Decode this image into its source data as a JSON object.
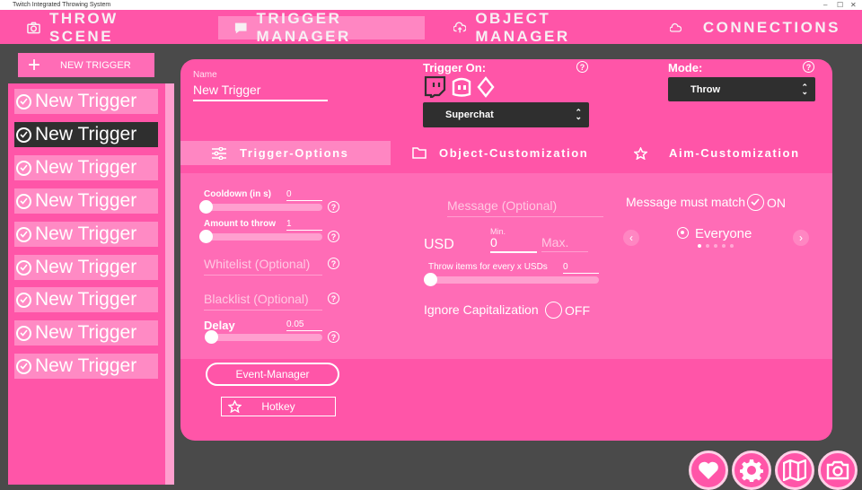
{
  "window": {
    "title": "Twitch Integrated Throwing System"
  },
  "nav": {
    "tabs": [
      {
        "label": "THROW SCENE",
        "icon": "camera-icon"
      },
      {
        "label": "TRIGGER MANAGER",
        "icon": "chat-icon",
        "active": true
      },
      {
        "label": "OBJECT MANAGER",
        "icon": "cloud-upload-icon"
      },
      {
        "label": "CONNECTIONS",
        "icon": "cloud-icon"
      }
    ]
  },
  "sidebar": {
    "new_trigger_label": "NEW TRIGGER",
    "items": [
      {
        "label": "New Trigger"
      },
      {
        "label": "New Trigger",
        "selected": true
      },
      {
        "label": "New Trigger"
      },
      {
        "label": "New Trigger"
      },
      {
        "label": "New Trigger"
      },
      {
        "label": "New Trigger"
      },
      {
        "label": "New Trigger"
      },
      {
        "label": "New Trigger"
      },
      {
        "label": "New Trigger"
      }
    ]
  },
  "trigger": {
    "name_label": "Name",
    "name_value": "New Trigger",
    "trigger_on_label": "Trigger On:",
    "trigger_on_value": "Superchat",
    "mode_label": "Mode:",
    "mode_value": "Throw",
    "help_glyph": "?"
  },
  "tabs": [
    {
      "label": "Trigger-Options",
      "icon": "sliders-icon",
      "active": true
    },
    {
      "label": "Object-Customization",
      "icon": "folder-icon"
    },
    {
      "label": "Aim-Customization",
      "icon": "star-icon"
    }
  ],
  "options": {
    "cooldown_label": "Cooldown (in s)",
    "cooldown_value": "0",
    "amount_label": "Amount to throw",
    "amount_value": "1",
    "whitelist_placeholder": "Whitelist (Optional)",
    "blacklist_placeholder": "Blacklist (Optional)",
    "delay_label": "Delay",
    "delay_value": "0.05",
    "message_placeholder": "Message (Optional)",
    "currency": "USD",
    "min_label": "Min.",
    "min_value": "0",
    "max_placeholder": "Max.",
    "throw_every_label": "Throw items for every x USDs",
    "throw_every_value": "0",
    "ignore_cap_label": "Ignore Capitalization",
    "ignore_cap_state": "OFF",
    "message_match_label": "Message must match",
    "message_match_state": "ON",
    "audience_value": "Everyone",
    "carousel_prev": "‹",
    "carousel_next": "›",
    "event_manager_label": "Event-Manager",
    "hotkey_label": "Hotkey"
  },
  "colors": {
    "accent": "#ff55a8",
    "accent_light": "#ff86c2",
    "dark": "#2f2f2f",
    "background": "#4a4a4a"
  },
  "fabs": [
    "heart-icon",
    "gear-icon",
    "map-icon",
    "camera-icon"
  ]
}
